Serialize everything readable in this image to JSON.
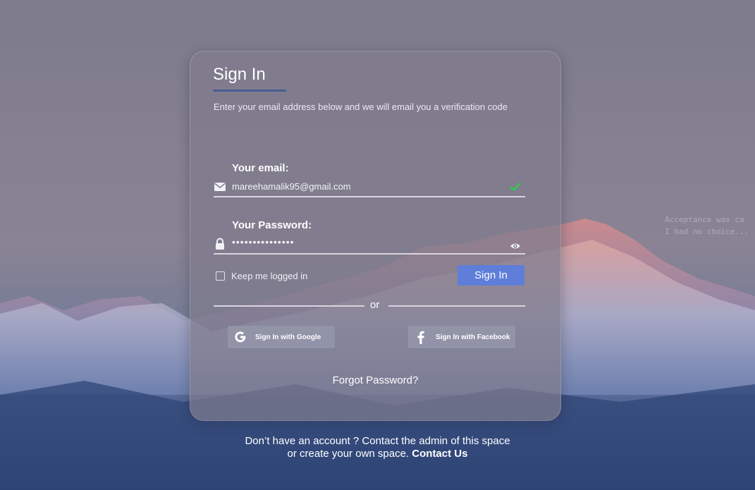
{
  "background": {
    "terminal_lines": [
      "Acceptance was ca",
      "I had no choice..."
    ]
  },
  "card": {
    "title": "Sign In",
    "subtitle": "Enter your email address below and we will email you a verification code",
    "email": {
      "label": "Your email:",
      "value": "mareehamalik95@gmail.com",
      "icon": "mail-icon",
      "status_icon": "check-icon"
    },
    "password": {
      "label": "Your Password:",
      "value": "•••••••••••••••",
      "icon": "lock-icon",
      "toggle_icon": "eye-icon"
    },
    "keep_logged_in": {
      "label": "Keep me logged in",
      "checked": false
    },
    "sign_in_button": "Sign In",
    "divider_text": "or",
    "google_button": "Sign In with Google",
    "facebook_button": "Sign In with Facebook",
    "forgot_password": "Forgot Password?"
  },
  "footer": {
    "line1": "Don’t have an account ? Contact the admin of this space",
    "line2": "or create your own space.",
    "contact_link": "Contact Us"
  },
  "colors": {
    "accent": "#5e7ed9",
    "title_underline": "#4a5c94",
    "check": "#2ecc40"
  }
}
